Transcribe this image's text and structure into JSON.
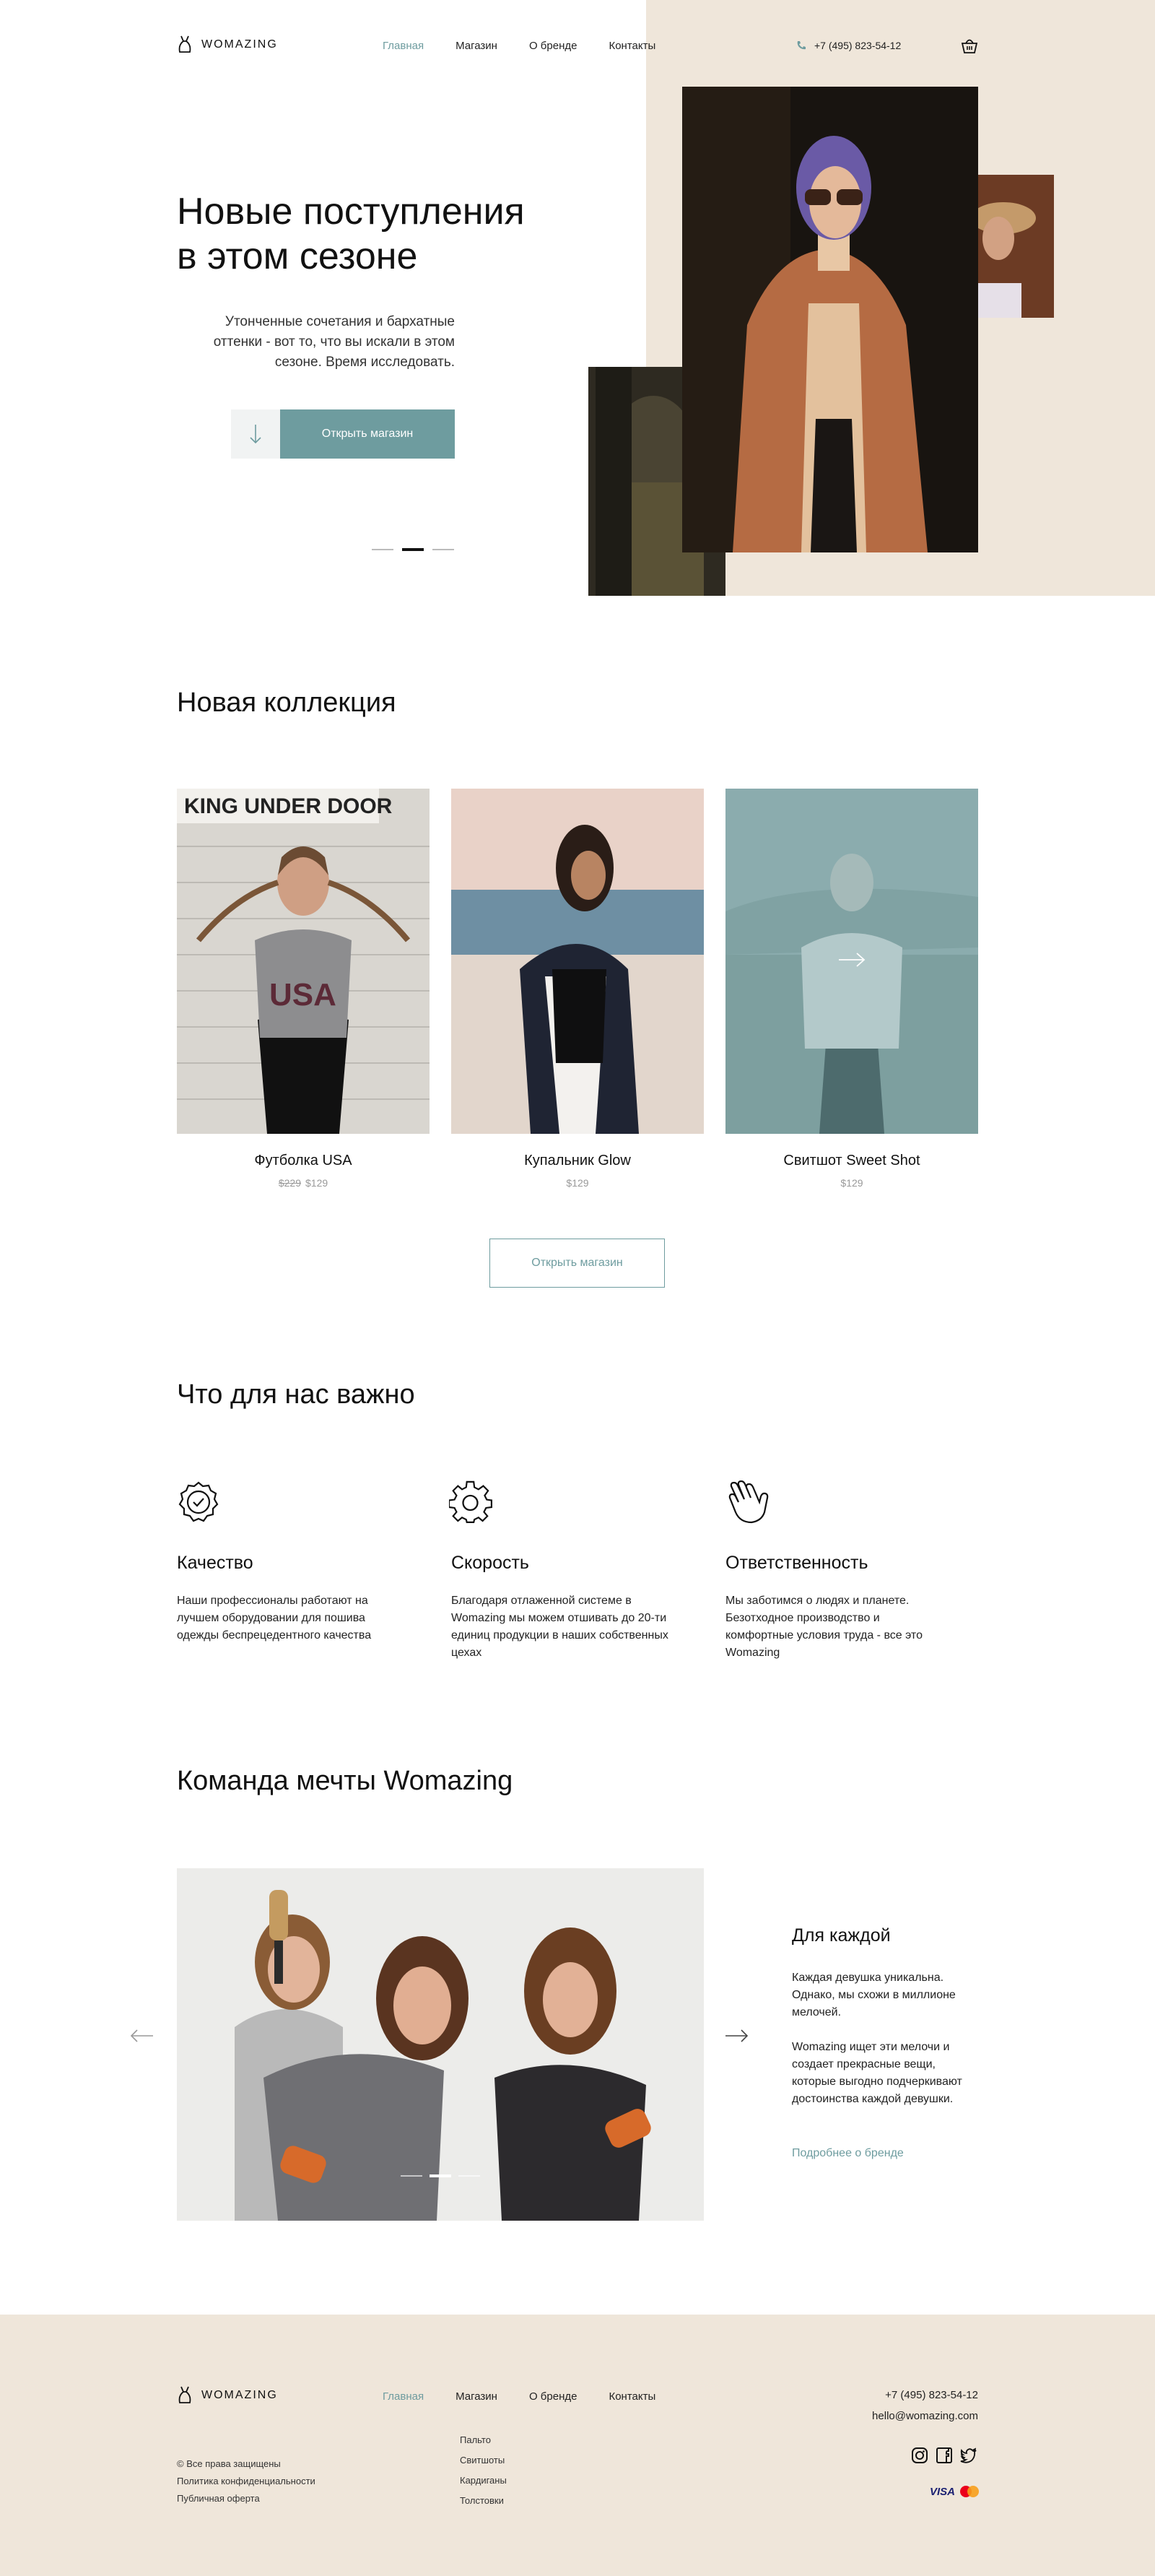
{
  "header": {
    "logo_text": "WOMAZING",
    "nav": [
      "Главная",
      "Магазин",
      "О бренде",
      "Контакты"
    ],
    "phone": "+7 (495) 823-54-12"
  },
  "hero": {
    "title_line1": "Новые поступления",
    "title_line2": "в этом сезоне",
    "subtitle": "Утонченные сочетания и бархатные оттенки - вот то, что вы искали в этом сезоне. Время исследовать.",
    "button_label": "Открыть магазин",
    "slides_total": 3,
    "slide_active": 2
  },
  "collection": {
    "title": "Новая коллекция",
    "products": [
      {
        "name": "Футболка USA",
        "old_price": "$229",
        "price": "$129"
      },
      {
        "name": "Купальник Glow",
        "old_price": "",
        "price": "$129"
      },
      {
        "name": "Свитшот Sweet Shot",
        "old_price": "",
        "price": "$129"
      }
    ],
    "button_label": "Открыть магазин"
  },
  "values": {
    "title": "Что для нас важно",
    "items": [
      {
        "title": "Качество",
        "text": "Наши профессионалы работают на лучшем оборудовании для пошива одежды беспрецедентного качества",
        "icon": "quality-badge-icon"
      },
      {
        "title": "Скорость",
        "text": "Благодаря отлаженной системе в Womazing мы можем отшивать до 20-ти единиц продукции в наших собственных цехах",
        "icon": "gear-icon"
      },
      {
        "title": "Ответственность",
        "text": "Мы заботимся о людях и планете. Безотходное производство и комфортные условия труда - все это Womazing",
        "icon": "hand-icon"
      }
    ]
  },
  "team": {
    "title": "Команда мечты Womazing",
    "subtitle": "Для каждой",
    "p1": "Каждая девушка уникальна. Однако, мы схожи в миллионе мелочей.",
    "p2": "Womazing ищет эти мелочи и создает прекрасные вещи, которые выгодно подчеркивают достоинства каждой девушки.",
    "link": "Подробнее о бренде",
    "slides_total": 3,
    "slide_active": 2
  },
  "footer": {
    "logo_text": "WOMAZING",
    "nav": [
      "Главная",
      "Магазин",
      "О бренде",
      "Контакты"
    ],
    "shop_links": [
      "Пальто",
      "Свитшоты",
      "Кардиганы",
      "Толстовки"
    ],
    "legal": [
      "© Все права защищены",
      "Политика конфиденциальности",
      "Публичная оферта"
    ],
    "phone": "+7 (495) 823-54-12",
    "email": "hello@womazing.com",
    "payment": "VISA"
  },
  "colors": {
    "accent": "#6e9c9f",
    "beige": "#efe6da"
  }
}
